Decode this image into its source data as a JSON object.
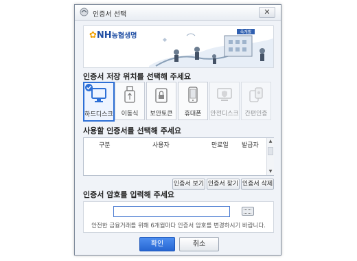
{
  "window": {
    "title": "인증서 선택",
    "close_label": "✕"
  },
  "banner": {
    "logo_mark": "✿",
    "logo_text": "NH",
    "logo_korean": "농협생명",
    "sign_text": "축개발"
  },
  "storage": {
    "heading": "인증서 저장 위치를 선택해 주세요",
    "devices": [
      {
        "label": "하드디스크",
        "icon": "monitor-icon",
        "selected": true,
        "enabled": true
      },
      {
        "label": "이동식",
        "icon": "usb-icon",
        "selected": false,
        "enabled": true
      },
      {
        "label": "보안토큰",
        "icon": "lock-token-icon",
        "selected": false,
        "enabled": true
      },
      {
        "label": "휴대폰",
        "icon": "phone-icon",
        "selected": false,
        "enabled": true
      },
      {
        "label": "안전디스크",
        "icon": "safe-disk-icon",
        "selected": false,
        "enabled": false
      },
      {
        "label": "간편인증",
        "icon": "easy-auth-icon",
        "selected": false,
        "enabled": false
      }
    ]
  },
  "certs": {
    "heading": "사용할 인증서를 선택해 주세요",
    "columns": [
      "구분",
      "사용자",
      "만료일",
      "발급자"
    ],
    "rows": []
  },
  "cert_actions": {
    "view": "인증서 보기",
    "find": "인증서 찾기",
    "delete": "인증서 삭제"
  },
  "password": {
    "heading": "인증서 암호를 입력해 주세요",
    "value": "",
    "notice": "안전한 금융거래를 위해 6개월마다 인증서 암호를 변경하시기 바랍니다."
  },
  "footer": {
    "ok": "확인",
    "cancel": "취소"
  },
  "colors": {
    "accent": "#2d6fd6",
    "ok_button": "#2f6fd8"
  }
}
